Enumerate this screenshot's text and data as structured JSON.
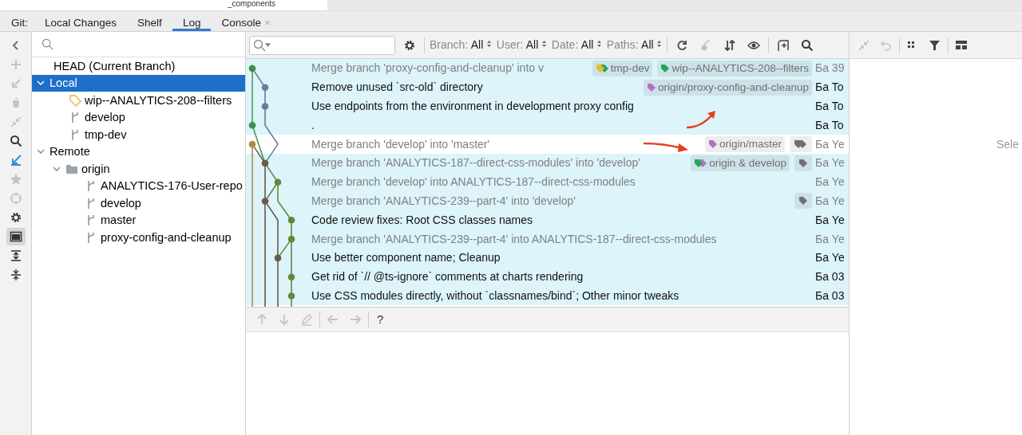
{
  "editor_strip": {
    "text": "_components"
  },
  "tool_window": {
    "label": "Git:",
    "tabs": [
      {
        "label": "Local Changes",
        "selected": false
      },
      {
        "label": "Shelf",
        "selected": false
      },
      {
        "label": "Log",
        "selected": true
      },
      {
        "label": "Console",
        "selected": false,
        "close": "×"
      }
    ]
  },
  "left_toolbar": [
    {
      "kind": "chevron",
      "disabled": false
    },
    {
      "kind": "plus",
      "disabled": true
    },
    {
      "kind": "arrow",
      "disabled": true
    },
    {
      "kind": "trash",
      "disabled": true
    },
    {
      "kind": "compress",
      "disabled": true
    },
    {
      "kind": "search",
      "disabled": false
    },
    {
      "kind": "checkout",
      "disabled": false
    },
    {
      "kind": "star",
      "disabled": true
    },
    {
      "kind": "target",
      "disabled": true
    },
    {
      "kind": "gear",
      "disabled": false
    },
    {
      "kind": "panel",
      "disabled": false,
      "selected": true
    },
    {
      "kind": "expand",
      "disabled": false
    },
    {
      "kind": "collapse",
      "disabled": false
    }
  ],
  "branches": {
    "items": [
      {
        "kind": "head",
        "label": "HEAD (Current Branch)",
        "selected": false
      },
      {
        "kind": "group",
        "label": "Local",
        "selected": true,
        "expanded": true,
        "children": [
          {
            "kind": "tag",
            "label": "wip--ANALYTICS-208--filters",
            "selected": false
          },
          {
            "kind": "branch",
            "label": "develop",
            "selected": false
          },
          {
            "kind": "branch",
            "label": "tmp-dev",
            "selected": false
          }
        ]
      },
      {
        "kind": "group",
        "label": "Remote",
        "selected": false,
        "expanded": true,
        "children": [
          {
            "kind": "folder",
            "label": "origin",
            "selected": false,
            "expanded": true,
            "children": [
              {
                "kind": "branch",
                "label": "ANALYTICS-176-User-repo",
                "selected": false
              },
              {
                "kind": "branch",
                "label": "develop",
                "selected": false
              },
              {
                "kind": "branch",
                "label": "master",
                "selected": false
              },
              {
                "kind": "branch",
                "label": "proxy-config-and-cleanup",
                "selected": false
              }
            ]
          }
        ]
      }
    ]
  },
  "log_toolbar": {
    "filters": [
      {
        "label": "Branch:",
        "value": "All"
      },
      {
        "label": "User:",
        "value": "All"
      },
      {
        "label": "Date:",
        "value": "All"
      },
      {
        "label": "Paths:",
        "value": "All"
      }
    ],
    "actions": [
      {
        "kind": "refresh",
        "disabled": false
      },
      {
        "kind": "cherry",
        "disabled": true
      },
      {
        "kind": "sort",
        "disabled": false
      },
      {
        "kind": "eye",
        "disabled": false
      },
      {
        "kind": "newtab",
        "disabled": false
      },
      {
        "kind": "search",
        "disabled": false
      }
    ]
  },
  "commits": [
    {
      "message": "Merge branch 'proxy-config-and-cleanup' into v",
      "merge": true,
      "selected": true,
      "author": "Ба",
      "date": "39",
      "tags": [
        {
          "kind": "label",
          "label": "tmp-dev",
          "icons": [
            {
              "color": "#e8c020"
            },
            {
              "color": "#25a55a"
            }
          ]
        },
        {
          "kind": "label",
          "label": "wip--ANALYTICS-208--filters",
          "icons": [
            {
              "color": "#25a55a"
            }
          ]
        }
      ]
    },
    {
      "message": "Remove unused `src-old` directory",
      "merge": false,
      "selected": true,
      "author": "Ба",
      "date": "To",
      "tags": [
        {
          "kind": "label",
          "label": "origin/proxy-config-and-cleanup",
          "icons": [
            {
              "color": "#b072c8"
            }
          ]
        }
      ]
    },
    {
      "message": "Use endpoints from the environment in development proxy config",
      "merge": false,
      "selected": true,
      "author": "Ба",
      "date": "To"
    },
    {
      "message": ".",
      "merge": false,
      "selected": true,
      "author": "Ба",
      "date": "To"
    },
    {
      "message": "Merge branch 'develop' into 'master'",
      "merge": true,
      "selected": false,
      "author": "Ба",
      "date": "Ye",
      "tags": [
        {
          "kind": "label",
          "label": "origin/master",
          "icons": [
            {
              "color": "#b072c8"
            }
          ]
        },
        {
          "kind": "more",
          "color": "#707070"
        }
      ]
    },
    {
      "message": "Merge branch 'ANALYTICS-187--direct-css-modules' into 'develop'",
      "merge": true,
      "selected": true,
      "author": "Ба",
      "date": "Ye",
      "tags": [
        {
          "kind": "label",
          "label": "origin & develop",
          "icons": [
            {
              "color": "#25a55a"
            },
            {
              "color": "#b072c8"
            }
          ]
        },
        {
          "kind": "single",
          "color": "#707070"
        }
      ]
    },
    {
      "message": "Merge branch 'develop' into ANALYTICS-187--direct-css-modules",
      "merge": true,
      "selected": true,
      "author": "Ба",
      "date": "Ye"
    },
    {
      "message": "Merge branch 'ANALYTICS-239--part-4' into 'develop'",
      "merge": true,
      "selected": true,
      "author": "Ба",
      "date": "Ye",
      "tags": [
        {
          "kind": "single",
          "color": "#707070"
        }
      ]
    },
    {
      "message": "Code review fixes: Root CSS classes names",
      "merge": false,
      "selected": true,
      "author": "Ба",
      "date": "Ye"
    },
    {
      "message": "Merge branch 'ANALYTICS-239--part-4' into ANALYTICS-187--direct-css-modules",
      "merge": true,
      "selected": true,
      "author": "Ба",
      "date": "Ye"
    },
    {
      "message": "Use better component name; Cleanup",
      "merge": false,
      "selected": true,
      "author": "Ба",
      "date": "Ye"
    },
    {
      "message": "Get rid of `// @ts-ignore` comments at charts rendering",
      "merge": false,
      "selected": true,
      "author": "Ба",
      "date": "03"
    },
    {
      "message": "Use CSS modules directly, without `classnames/bind`; Other minor tweaks",
      "merge": false,
      "selected": true,
      "author": "Ба",
      "date": "03"
    }
  ],
  "details_toolbar": [
    {
      "kind": "compress",
      "disabled": true
    },
    {
      "kind": "undo",
      "disabled": true
    },
    {
      "kind": "grid",
      "disabled": false
    },
    {
      "kind": "filter",
      "disabled": false
    },
    {
      "kind": "layout",
      "disabled": false
    }
  ],
  "bottom_toolbar": [
    {
      "kind": "up",
      "disabled": true
    },
    {
      "kind": "down",
      "disabled": true
    },
    {
      "kind": "edit",
      "disabled": true
    },
    {
      "kind": "left",
      "disabled": true
    },
    {
      "kind": "right",
      "disabled": true
    }
  ],
  "help": "?",
  "details": {
    "placeholder_text": "Sele"
  }
}
